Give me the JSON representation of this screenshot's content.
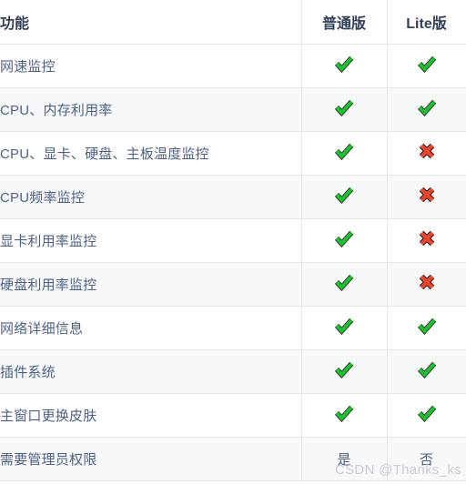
{
  "table": {
    "columns": [
      {
        "key": "feature",
        "label": "功能",
        "align": "left"
      },
      {
        "key": "standard",
        "label": "普通版",
        "align": "center"
      },
      {
        "key": "lite",
        "label": "Lite版",
        "align": "center"
      }
    ],
    "rows": [
      {
        "feature": "网速监控",
        "standard": "check",
        "lite": "check"
      },
      {
        "feature": "CPU、内存利用率",
        "standard": "check",
        "lite": "check"
      },
      {
        "feature": "CPU、显卡、硬盘、主板温度监控",
        "standard": "check",
        "lite": "cross"
      },
      {
        "feature": "CPU频率监控",
        "standard": "check",
        "lite": "cross"
      },
      {
        "feature": "显卡利用率监控",
        "standard": "check",
        "lite": "cross"
      },
      {
        "feature": "硬盘利用率监控",
        "standard": "check",
        "lite": "cross"
      },
      {
        "feature": "网络详细信息",
        "standard": "check",
        "lite": "check"
      },
      {
        "feature": "插件系统",
        "standard": "check",
        "lite": "check"
      },
      {
        "feature": "主窗口更换皮肤",
        "standard": "check",
        "lite": "check"
      },
      {
        "feature": "需要管理员权限",
        "standard": "是",
        "lite": "否"
      }
    ]
  },
  "watermark": {
    "text": "CSDN @Thanks_ks"
  },
  "icons": {
    "check": "check-mark-icon",
    "cross": "cross-mark-icon"
  },
  "colors": {
    "check_green": "#22bb33",
    "cross_red": "#e8452c",
    "header_text": "#32405a",
    "body_text": "#4e6183",
    "row_alt_bg": "#f6f8fa",
    "row_bg": "#ffffff",
    "border": "#e3e6eb",
    "watermark_text": "#c8cdd4"
  }
}
